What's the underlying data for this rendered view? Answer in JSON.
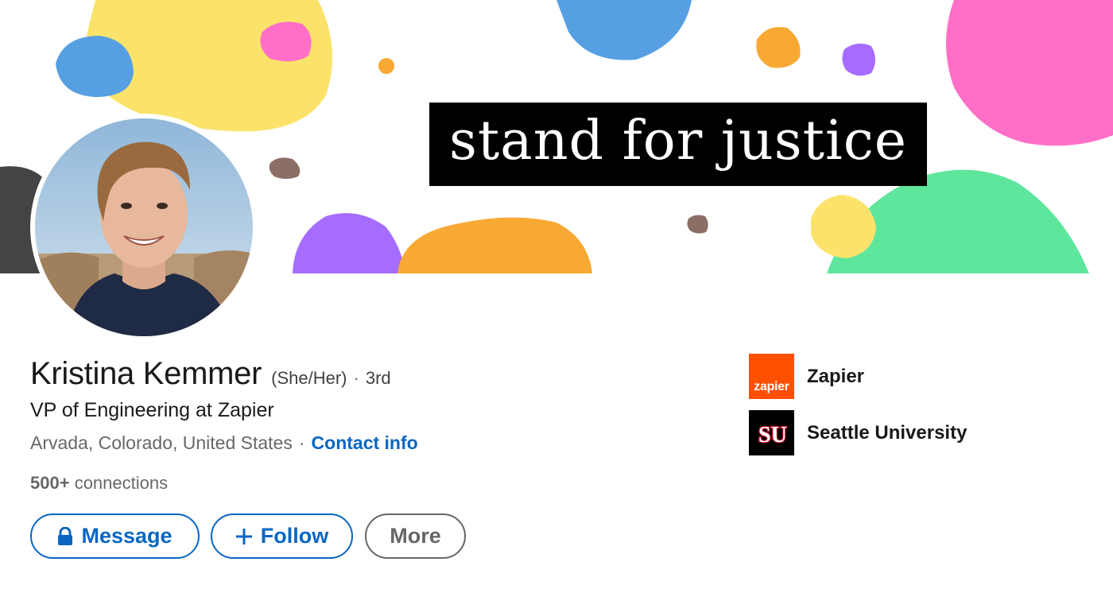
{
  "cover": {
    "banner_text": "stand for justice"
  },
  "profile": {
    "name": "Kristina Kemmer",
    "pronouns": "(She/Her)",
    "separator": "·",
    "degree": "3rd",
    "headline": "VP of Engineering at Zapier",
    "location": "Arvada, Colorado, United States",
    "location_separator": "·",
    "contact_info_label": "Contact info",
    "connections_count": "500+",
    "connections_label": "connections"
  },
  "actions": {
    "message_label": "Message",
    "follow_label": "Follow",
    "more_label": "More",
    "message_icon": "lock-icon",
    "follow_icon": "plus-icon"
  },
  "organizations": [
    {
      "name": "Zapier",
      "logo_text": "zapier",
      "logo_color": "#ff4f00"
    },
    {
      "name": "Seattle University",
      "logo_text": "SU",
      "logo_color": "#000000"
    }
  ],
  "colors": {
    "link_blue": "#0a66c2",
    "more_gray": "#666666"
  }
}
